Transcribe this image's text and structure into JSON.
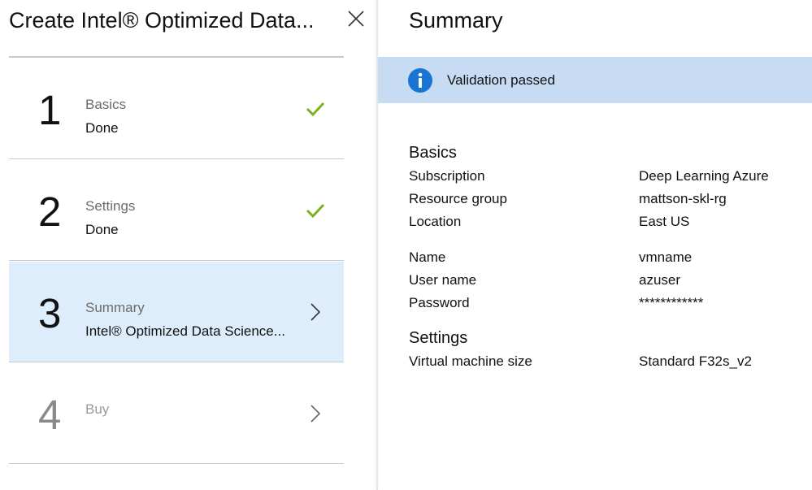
{
  "left": {
    "title": "Create Intel® Optimized Data...",
    "close_icon": "close-icon",
    "steps": [
      {
        "number": "1",
        "label": "Basics",
        "subtitle": "Done",
        "status": "done",
        "icon": "checkmark-icon"
      },
      {
        "number": "2",
        "label": "Settings",
        "subtitle": "Done",
        "status": "done",
        "icon": "checkmark-icon"
      },
      {
        "number": "3",
        "label": "Summary",
        "subtitle": "Intel® Optimized Data Science...",
        "status": "active",
        "icon": "chevron-right-icon"
      },
      {
        "number": "4",
        "label": "Buy",
        "subtitle": "",
        "status": "disabled",
        "icon": "chevron-right-icon"
      }
    ]
  },
  "right": {
    "title": "Summary",
    "validation": {
      "text": "Validation passed",
      "icon": "info-icon"
    },
    "basics": {
      "heading": "Basics",
      "rows": [
        {
          "label": "Subscription",
          "value": "Deep Learning Azure"
        },
        {
          "label": "Resource group",
          "value": "mattson-skl-rg"
        },
        {
          "label": "Location",
          "value": "East US"
        },
        {
          "label": "Name",
          "value": "vmname"
        },
        {
          "label": "User name",
          "value": "azuser"
        },
        {
          "label": "Password",
          "value": "************"
        }
      ]
    },
    "settings": {
      "heading": "Settings",
      "rows": [
        {
          "label": "Virtual machine size",
          "value": "Standard F32s_v2"
        }
      ]
    }
  },
  "colors": {
    "check": "#7db21f",
    "active_step_bg": "#deedfc",
    "validation_bg": "#c7dcf3",
    "info_icon": "#1a75d2"
  }
}
